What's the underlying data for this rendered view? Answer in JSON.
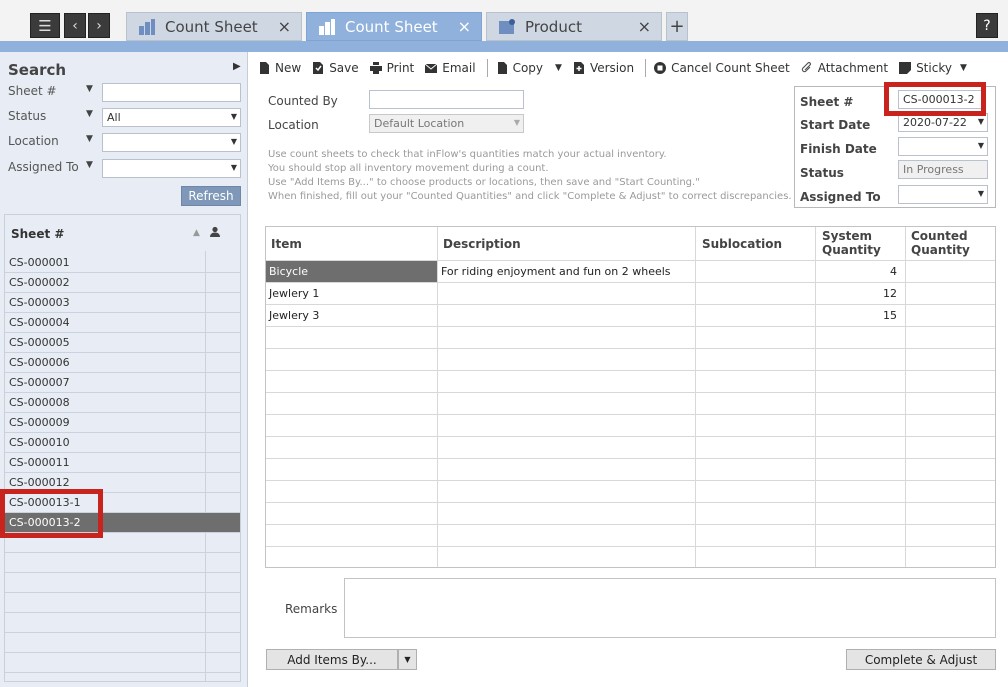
{
  "tabs": [
    {
      "label": "Count Sheet",
      "active": false
    },
    {
      "label": "Count Sheet",
      "active": true
    },
    {
      "label": "Product",
      "active": false
    }
  ],
  "help_label": "?",
  "search": {
    "title": "Search",
    "fields": [
      {
        "label": "Sheet #",
        "value": ""
      },
      {
        "label": "Status",
        "value": "All"
      },
      {
        "label": "Location",
        "value": ""
      },
      {
        "label": "Assigned To",
        "value": ""
      }
    ],
    "refresh_label": "Refresh"
  },
  "list": {
    "header": "Sheet #",
    "rows": [
      "CS-000001",
      "CS-000002",
      "CS-000003",
      "CS-000004",
      "CS-000005",
      "CS-000006",
      "CS-000007",
      "CS-000008",
      "CS-000009",
      "CS-000010",
      "CS-000011",
      "CS-000012",
      "CS-000013-1",
      "CS-000013-2"
    ],
    "selected": "CS-000013-2"
  },
  "toolbar": {
    "new": "New",
    "save": "Save",
    "print": "Print",
    "email": "Email",
    "copy": "Copy",
    "version": "Version",
    "cancel": "Cancel Count Sheet",
    "attachment": "Attachment",
    "sticky": "Sticky"
  },
  "form": {
    "counted_by_label": "Counted By",
    "counted_by_value": "",
    "location_label": "Location",
    "location_value": "Default Location",
    "hints": [
      "Use count sheets to check that inFlow's quantities match your actual inventory.",
      "You should stop all inventory movement during a count.",
      "Use \"Add Items By...\" to choose products or locations, then save and \"Start Counting.\"",
      "When finished, fill out your \"Counted Quantities\" and click \"Complete & Adjust\" to correct discrepancies."
    ]
  },
  "sheet_info": {
    "sheet_label": "Sheet #",
    "sheet_value": "CS-000013-2",
    "start_label": "Start Date",
    "start_value": "2020-07-22",
    "finish_label": "Finish Date",
    "finish_value": "",
    "status_label": "Status",
    "status_value": "In Progress",
    "assigned_label": "Assigned To",
    "assigned_value": ""
  },
  "grid": {
    "headers": {
      "item": "Item",
      "description": "Description",
      "sublocation": "Sublocation",
      "system_1": "System",
      "system_2": "Quantity",
      "counted_1": "Counted",
      "counted_2": "Quantity"
    },
    "rows": [
      {
        "item": "Bicycle",
        "description": "For riding enjoyment and fun on 2 wheels",
        "sublocation": "",
        "system_qty": "4",
        "counted": ""
      },
      {
        "item": "Jewlery 1",
        "description": "",
        "sublocation": "",
        "system_qty": "12",
        "counted": ""
      },
      {
        "item": "Jewlery 3",
        "description": "",
        "sublocation": "",
        "system_qty": "15",
        "counted": ""
      }
    ]
  },
  "remarks_label": "Remarks",
  "remarks_value": "",
  "add_items_label": "Add Items By...",
  "complete_label": "Complete & Adjust",
  "colors": {
    "accent": "#8fb1dc",
    "highlight": "#c8231c",
    "selected_row": "#6e6e6e"
  }
}
